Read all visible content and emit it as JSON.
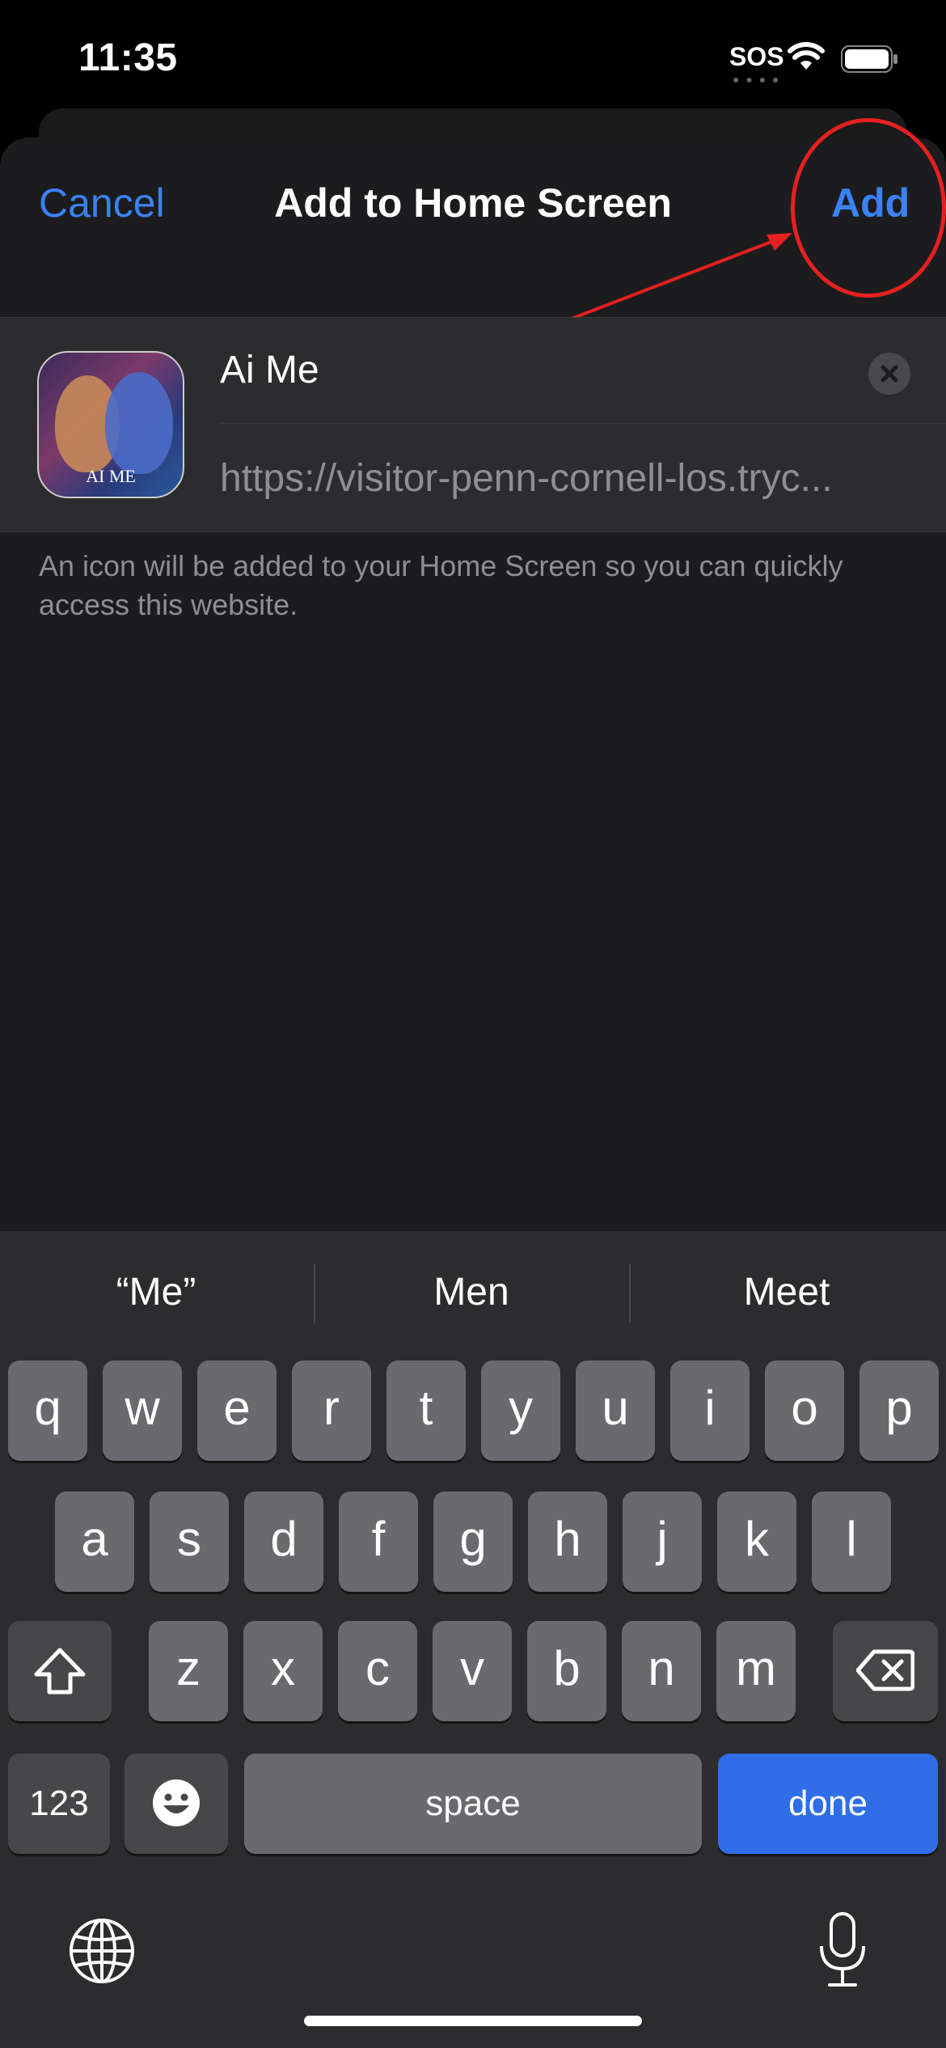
{
  "status_bar": {
    "time": "11:35",
    "sos": "SOS"
  },
  "nav": {
    "cancel": "Cancel",
    "title": "Add to Home Screen",
    "add": "Add"
  },
  "form": {
    "name": "Ai Me",
    "url": "https://visitor-penn-cornell-los.tryc...",
    "icon_label": "AI ME"
  },
  "helper_text": "An icon will be added to your Home Screen so you can quickly access this website.",
  "suggestions": [
    "“Me”",
    "Men",
    "Meet"
  ],
  "keyboard": {
    "row1": [
      "q",
      "w",
      "e",
      "r",
      "t",
      "y",
      "u",
      "i",
      "o",
      "p"
    ],
    "row2": [
      "a",
      "s",
      "d",
      "f",
      "g",
      "h",
      "j",
      "k",
      "l"
    ],
    "row3": [
      "z",
      "x",
      "c",
      "v",
      "b",
      "n",
      "m"
    ],
    "numbers": "123",
    "space": "space",
    "done": "done"
  },
  "colors": {
    "accent": "#3b82f6",
    "annotation": "#e52020"
  }
}
